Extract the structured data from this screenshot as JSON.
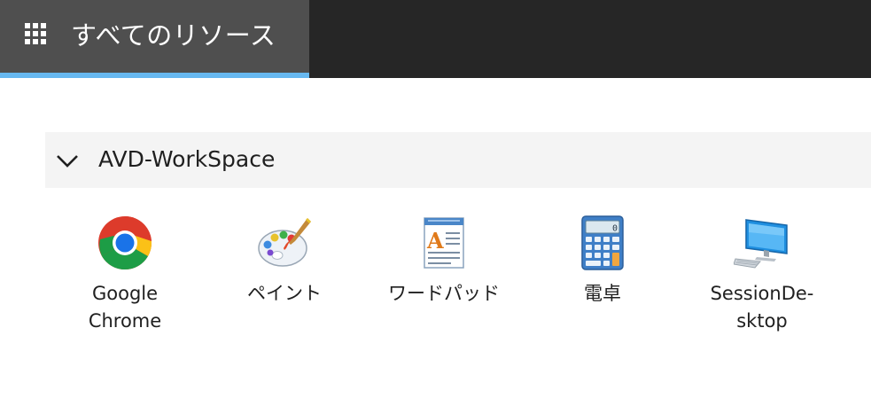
{
  "header": {
    "tab_title": "すべてのリソース",
    "tab_icon": "grid-icon",
    "accent_color": "#67b8f0"
  },
  "workspace": {
    "title": "AVD-WorkSpace",
    "expanded": true,
    "apps": [
      {
        "label_line1": "Google",
        "label_line2": "Chrome",
        "icon": "chrome-icon"
      },
      {
        "label_line1": "ペイント",
        "label_line2": "",
        "icon": "paint-palette-icon"
      },
      {
        "label_line1": "ワードパッド",
        "label_line2": "",
        "icon": "wordpad-icon"
      },
      {
        "label_line1": "電卓",
        "label_line2": "",
        "icon": "calculator-icon"
      },
      {
        "label_line1": "SessionDe-",
        "label_line2": "sktop",
        "icon": "desktop-computer-icon"
      }
    ]
  }
}
